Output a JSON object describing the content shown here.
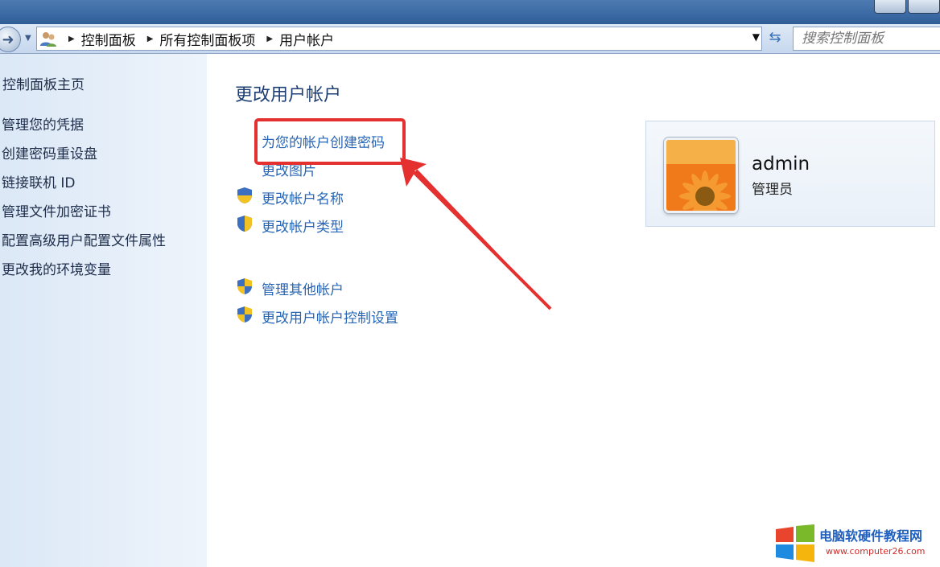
{
  "addressbar": {
    "crumbs": [
      "控制面板",
      "所有控制面板项",
      "用户帐户"
    ],
    "search_placeholder": "搜索控制面板"
  },
  "sidebar": {
    "home": "控制面板主页",
    "items": [
      {
        "label": "管理您的凭据"
      },
      {
        "label": "创建密码重设盘"
      },
      {
        "label": "链接联机 ID"
      },
      {
        "label": "管理文件加密证书"
      },
      {
        "label": "配置高级用户配置文件属性"
      },
      {
        "label": "更改我的环境变量"
      }
    ]
  },
  "main": {
    "title": "更改用户帐户",
    "links": [
      {
        "label": "为您的帐户创建密码",
        "shield": false
      },
      {
        "label": "更改图片",
        "shield": false
      },
      {
        "label": "更改帐户名称",
        "shield": true
      },
      {
        "label": "更改帐户类型",
        "shield": true
      }
    ],
    "other_links": [
      {
        "label": "管理其他帐户",
        "shield": true
      },
      {
        "label": "更改用户帐户控制设置",
        "shield": true
      }
    ]
  },
  "user": {
    "name": "admin",
    "role": "管理员",
    "avatar_icon": "flower-avatar-icon"
  },
  "annotation": {
    "color": "#e53030"
  },
  "watermark": {
    "title": "电脑软硬件教程网",
    "url": "www.computer26.com"
  }
}
